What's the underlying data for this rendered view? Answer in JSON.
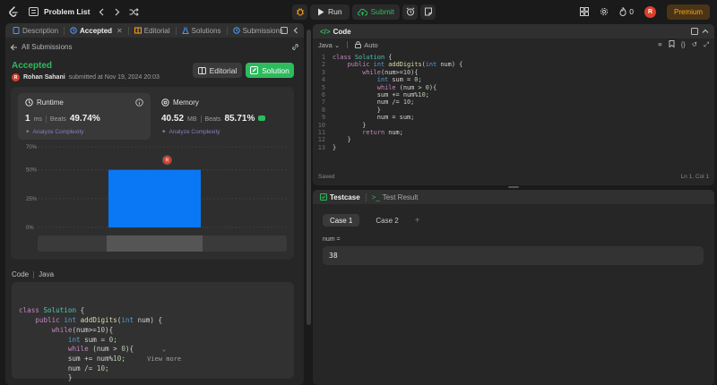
{
  "topbar": {
    "title": "Problem List",
    "run_label": "Run",
    "submit_label": "Submit",
    "streak_count": "0",
    "avatar_initial": "R",
    "premium_label": "Premium"
  },
  "left_tabs": {
    "description": "Description",
    "accepted": "Accepted",
    "editorial": "Editorial",
    "solutions": "Solutions",
    "submissions": "Submissions"
  },
  "submission": {
    "back_label": "All Submissions",
    "status": "Accepted",
    "author": "Rohan Sahani",
    "submitted_text": "submitted at Nov 19, 2024 20:03",
    "editorial_button": "Editorial",
    "solution_button": "Solution"
  },
  "runtime": {
    "title": "Runtime",
    "value": "1",
    "unit": "ms",
    "beats_label": "Beats",
    "beats_pct": "49.74%",
    "analyze": "Analyze Complexity"
  },
  "memory": {
    "title": "Memory",
    "value": "40.52",
    "unit": "MB",
    "beats_label": "Beats",
    "beats_pct": "85.71%",
    "analyze": "Analyze Complexity"
  },
  "chart_data": {
    "type": "bar",
    "categories": [
      ""
    ],
    "values": [
      50
    ],
    "ytick_labels": [
      "70%",
      "50%",
      "25%",
      "0%"
    ],
    "yticks": [
      70,
      50,
      25,
      0
    ],
    "ylim": [
      0,
      70
    ],
    "marker_label": "R",
    "grid": true
  },
  "code_preview": {
    "label": "Code",
    "language": "Java",
    "lines": [
      "class Solution {",
      "    public int addDigits(int num) {",
      "        while(num>=10){",
      "            int sum = 0;",
      "            while (num > 0){",
      "            sum += num%10;",
      "            num /= 10;",
      "            }"
    ],
    "view_more": "View more"
  },
  "code_panel": {
    "title": "Code",
    "language": "Java",
    "mode": "Auto",
    "saved": "Saved",
    "cursor": "Ln 1, Col 1",
    "lines": [
      "class Solution {",
      "    public int addDigits(int num) {",
      "        while(num>=10){",
      "            int sum = 0;",
      "            while (num > 0){",
      "            sum += num%10;",
      "            num /= 10;",
      "            }",
      "            num = sum;",
      "        }",
      "        return num;",
      "    }",
      "}"
    ],
    "line_numbers": [
      "1",
      "2",
      "3",
      "4",
      "5",
      "6",
      "7",
      "8",
      "9",
      "10",
      "11",
      "12",
      "13"
    ]
  },
  "testcase": {
    "tab_testcase": "Testcase",
    "tab_result": "Test Result",
    "cases": [
      "Case 1",
      "Case 2"
    ],
    "plus": "+",
    "var_label": "num =",
    "value": "38"
  }
}
